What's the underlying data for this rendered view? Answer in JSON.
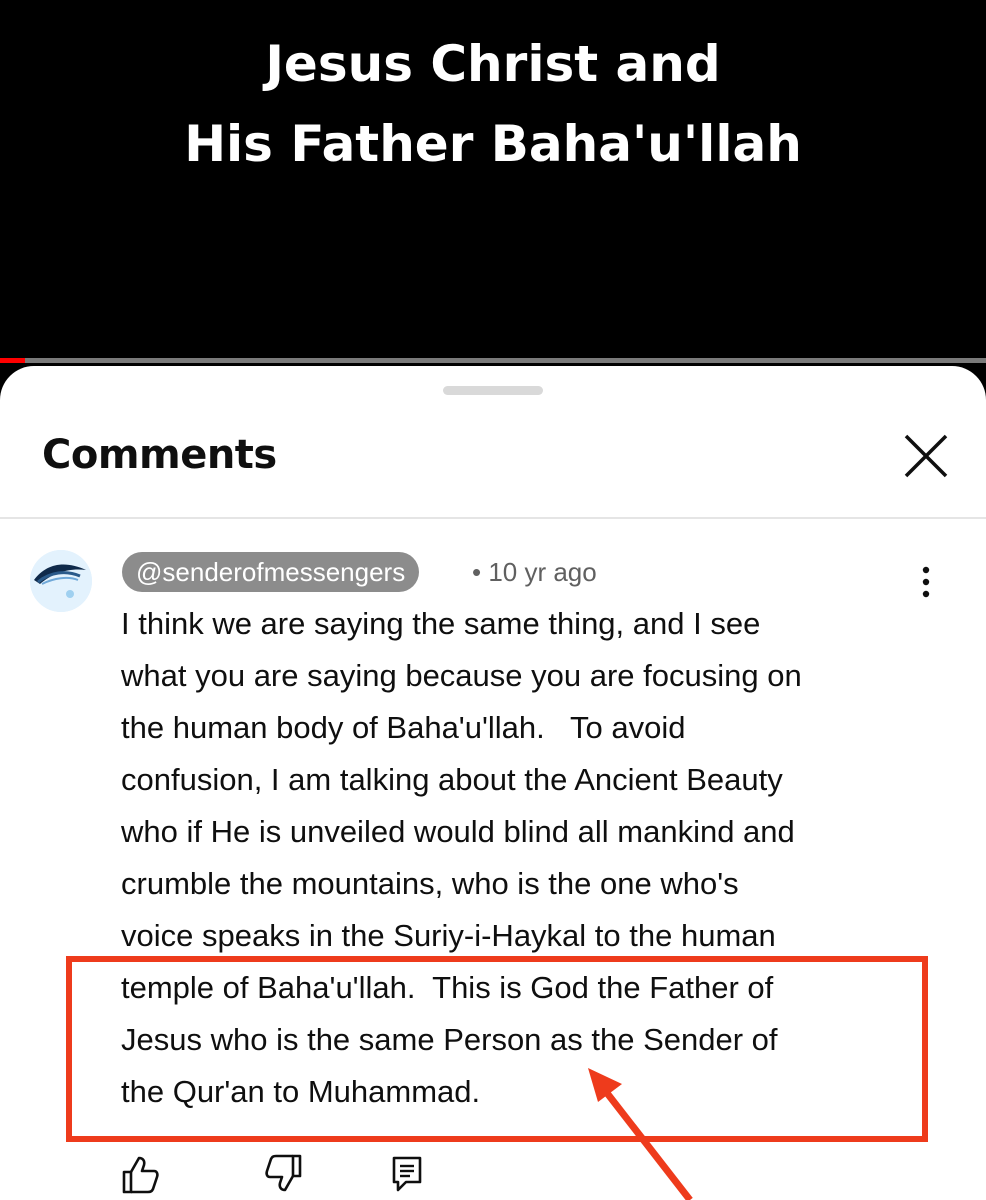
{
  "video": {
    "title_line1": "Jesus Christ and",
    "title_line2": "His Father Baha'u'llah",
    "progress_percent": 2.5
  },
  "comments_sheet": {
    "title": "Comments",
    "close_icon": "close-icon"
  },
  "comment": {
    "author": "@senderofmessengers",
    "meta": "• 10 yr ago",
    "lines": [
      "I think we are saying the same thing, and I see",
      "what you are saying because you are focusing on",
      "the human body of Baha'u'llah.   To avoid",
      "confusion, I am talking about the Ancient Beauty",
      "who if He is unveiled would blind all mankind and",
      "crumble the mountains, who is the one who's",
      "voice speaks in the Suriy-i-Haykal to the human",
      "temple of Baha'u'llah.  This is God the Father of",
      "Jesus who is the same Person as the Sender of",
      "the Qur'an to Muhammad."
    ],
    "actions": [
      "thumbs-up-icon",
      "thumbs-down-icon",
      "reply-icon"
    ],
    "more_icon": "more-vert-icon"
  },
  "annotation": {
    "highlight_color": "#ee3b1c"
  },
  "colors": {
    "progress": "#ff0000",
    "chip": "#8c8c8c"
  }
}
